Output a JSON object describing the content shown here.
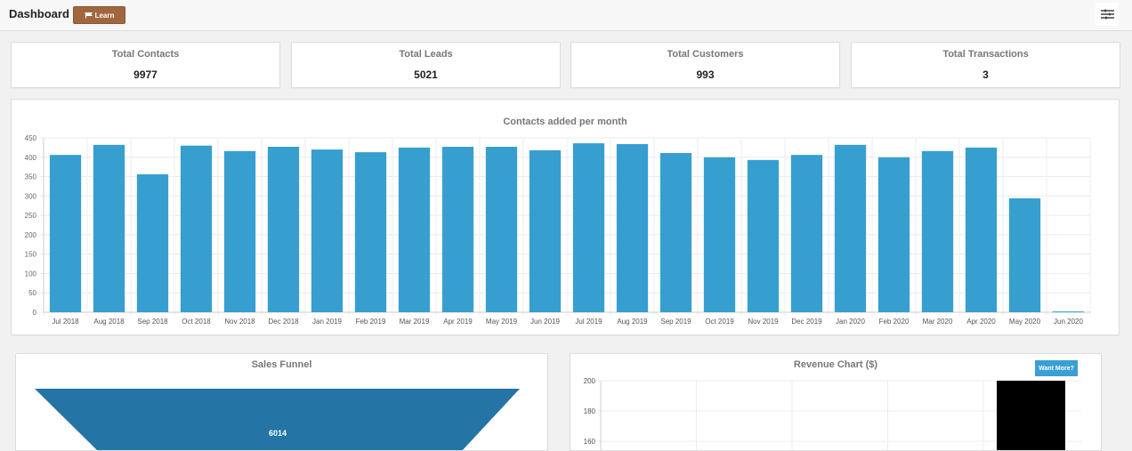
{
  "header": {
    "title": "Dashboard",
    "learn_label": "Learn",
    "learn_icon": "flag-icon",
    "menu_icon": "sliders-icon"
  },
  "stats": [
    {
      "label": "Total Contacts",
      "value": "9977"
    },
    {
      "label": "Total Leads",
      "value": "5021"
    },
    {
      "label": "Total Customers",
      "value": "993"
    },
    {
      "label": "Total Transactions",
      "value": "3"
    }
  ],
  "colors": {
    "bar": "#379fcf",
    "funnel": "#2474a6",
    "revenue_bar": "#000000",
    "learn_button": "#a0673f",
    "want_more": "#3a9fd5"
  },
  "chart_data": [
    {
      "type": "bar",
      "title": "Contacts added per month",
      "xlabel": "",
      "ylabel": "",
      "ylim": [
        0,
        450
      ],
      "yticks": [
        0,
        50,
        100,
        150,
        200,
        250,
        300,
        350,
        400,
        450
      ],
      "grid": true,
      "categories": [
        "Jul 2018",
        "Aug 2018",
        "Sep 2018",
        "Oct 2018",
        "Nov 2018",
        "Dec 2018",
        "Jan 2019",
        "Feb 2019",
        "Mar 2019",
        "Apr 2019",
        "May 2019",
        "Jun 2019",
        "Jul 2019",
        "Aug 2019",
        "Sep 2019",
        "Oct 2019",
        "Nov 2019",
        "Dec 2019",
        "Jan 2020",
        "Feb 2020",
        "Mar 2020",
        "Apr 2020",
        "May 2020",
        "Jun 2020"
      ],
      "values": [
        406,
        432,
        356,
        430,
        416,
        427,
        420,
        413,
        425,
        427,
        427,
        418,
        436,
        434,
        411,
        400,
        393,
        406,
        432,
        400,
        416,
        425,
        294,
        2
      ]
    },
    {
      "type": "funnel",
      "title": "Sales Funnel",
      "stages": [
        {
          "value": 6014
        }
      ]
    },
    {
      "type": "bar",
      "title": "Revenue Chart ($)",
      "visible_yticks": [
        200,
        180,
        160
      ],
      "grid": true,
      "visible_bars": [
        {
          "value_at_least": 200
        }
      ],
      "button_label": "Want More?"
    }
  ]
}
